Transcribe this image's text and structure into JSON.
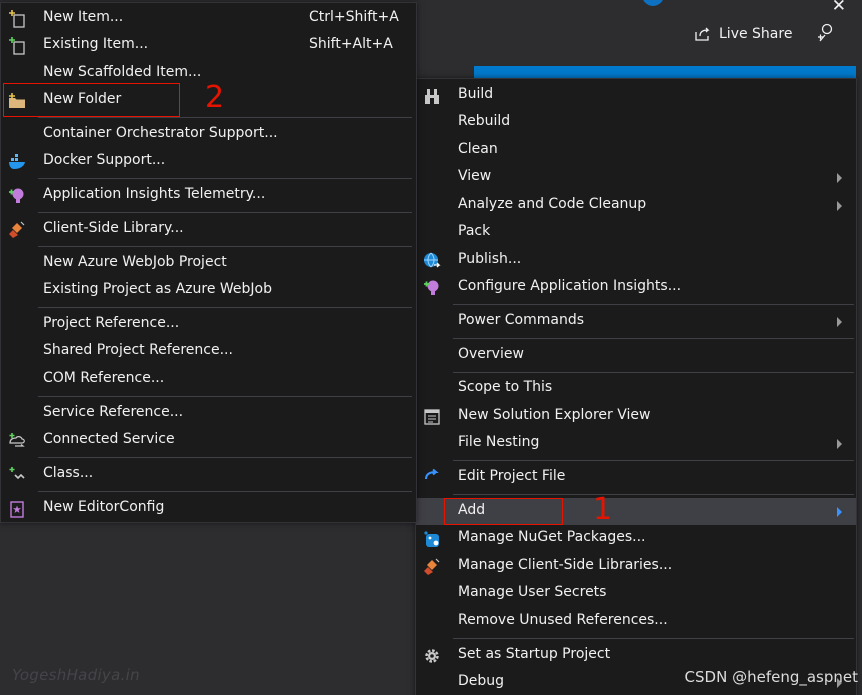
{
  "topbar": {
    "live_share_label": "Live Share",
    "close_glyph": "✕"
  },
  "left_menu": {
    "items": [
      {
        "label": "New Item...",
        "shortcut": "Ctrl+Shift+A",
        "icon": "new-item-icon"
      },
      {
        "label": "Existing Item...",
        "shortcut": "Shift+Alt+A",
        "icon": "existing-item-icon"
      },
      {
        "label": "New Scaffolded Item...",
        "shortcut": "",
        "icon": ""
      },
      {
        "label": "New Folder",
        "shortcut": "",
        "icon": "folder-icon"
      },
      {
        "label": "Container Orchestrator Support...",
        "shortcut": "",
        "icon": ""
      },
      {
        "label": "Docker Support...",
        "shortcut": "",
        "icon": "docker-icon"
      },
      {
        "label": "Application Insights Telemetry...",
        "shortcut": "",
        "icon": "app-insights-icon"
      },
      {
        "label": "Client-Side Library...",
        "shortcut": "",
        "icon": "library-icon"
      },
      {
        "label": "New Azure WebJob Project",
        "shortcut": "",
        "icon": ""
      },
      {
        "label": "Existing Project as Azure WebJob",
        "shortcut": "",
        "icon": ""
      },
      {
        "label": "Project Reference...",
        "shortcut": "",
        "icon": ""
      },
      {
        "label": "Shared Project Reference...",
        "shortcut": "",
        "icon": ""
      },
      {
        "label": "COM Reference...",
        "shortcut": "",
        "icon": ""
      },
      {
        "label": "Service Reference...",
        "shortcut": "",
        "icon": ""
      },
      {
        "label": "Connected Service",
        "shortcut": "",
        "icon": "connected-service-icon"
      },
      {
        "label": "Class...",
        "shortcut": "",
        "icon": "class-icon"
      },
      {
        "label": "New EditorConfig",
        "shortcut": "",
        "icon": "editorconfig-icon"
      }
    ]
  },
  "right_menu": {
    "items": [
      {
        "label": "Build",
        "submenu": false,
        "icon": "build-icon"
      },
      {
        "label": "Rebuild",
        "submenu": false,
        "icon": ""
      },
      {
        "label": "Clean",
        "submenu": false,
        "icon": ""
      },
      {
        "label": "View",
        "submenu": true,
        "icon": ""
      },
      {
        "label": "Analyze and Code Cleanup",
        "submenu": true,
        "icon": ""
      },
      {
        "label": "Pack",
        "submenu": false,
        "icon": ""
      },
      {
        "label": "Publish...",
        "submenu": false,
        "icon": "publish-globe-icon"
      },
      {
        "label": "Configure Application Insights...",
        "submenu": false,
        "icon": "app-insights-icon"
      },
      {
        "label": "Power Commands",
        "submenu": true,
        "icon": ""
      },
      {
        "label": "Overview",
        "submenu": false,
        "icon": ""
      },
      {
        "label": "Scope to This",
        "submenu": false,
        "icon": ""
      },
      {
        "label": "New Solution Explorer View",
        "submenu": false,
        "icon": "new-view-icon"
      },
      {
        "label": "File Nesting",
        "submenu": true,
        "icon": ""
      },
      {
        "label": "Edit Project File",
        "submenu": false,
        "icon": "edit-project-icon"
      },
      {
        "label": "Add",
        "submenu": true,
        "icon": ""
      },
      {
        "label": "Manage NuGet Packages...",
        "submenu": false,
        "icon": "nuget-icon"
      },
      {
        "label": "Manage Client-Side Libraries...",
        "submenu": false,
        "icon": "library-icon"
      },
      {
        "label": "Manage User Secrets",
        "submenu": false,
        "icon": ""
      },
      {
        "label": "Remove Unused References...",
        "submenu": false,
        "icon": ""
      },
      {
        "label": "Set as Startup Project",
        "submenu": false,
        "icon": "gear-icon"
      },
      {
        "label": "Debug",
        "submenu": true,
        "icon": ""
      }
    ]
  },
  "annotations": {
    "step1": "1",
    "step2": "2"
  },
  "watermarks": {
    "left": "YogeshHadiya.in",
    "right": "CSDN @hefeng_aspnet"
  },
  "colors": {
    "accent": "#007acc",
    "annotation_red": "#e51400",
    "menu_bg": "#1b1b1c",
    "highlight_bg": "#3f3f46"
  }
}
